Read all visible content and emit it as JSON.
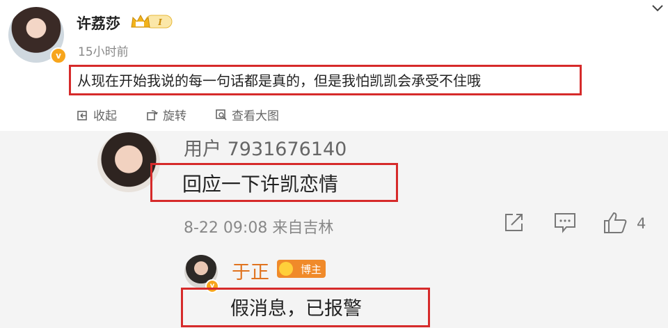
{
  "post": {
    "author": "许荔莎",
    "level_badge": "I",
    "time": "15小时前",
    "text": "从现在开始我说的每一句话都是真的，但是我怕凯凯会承受不住哦",
    "actions": {
      "collapse": "收起",
      "rotate": "旋转",
      "view_large": "查看大图"
    }
  },
  "comment": {
    "user": "用户 7931676140",
    "text": "回应一下许凯恋情",
    "meta": "8-22 09:08 来自吉林",
    "likes": "4"
  },
  "reply": {
    "user": "于正",
    "badge": "博主",
    "text": "假消息，已报警"
  },
  "colors": {
    "highlight_box": "#d62a2a",
    "verified": "#f7a51c",
    "blogger_name": "#e0731f",
    "comment_bg": "#f4f4f4"
  }
}
